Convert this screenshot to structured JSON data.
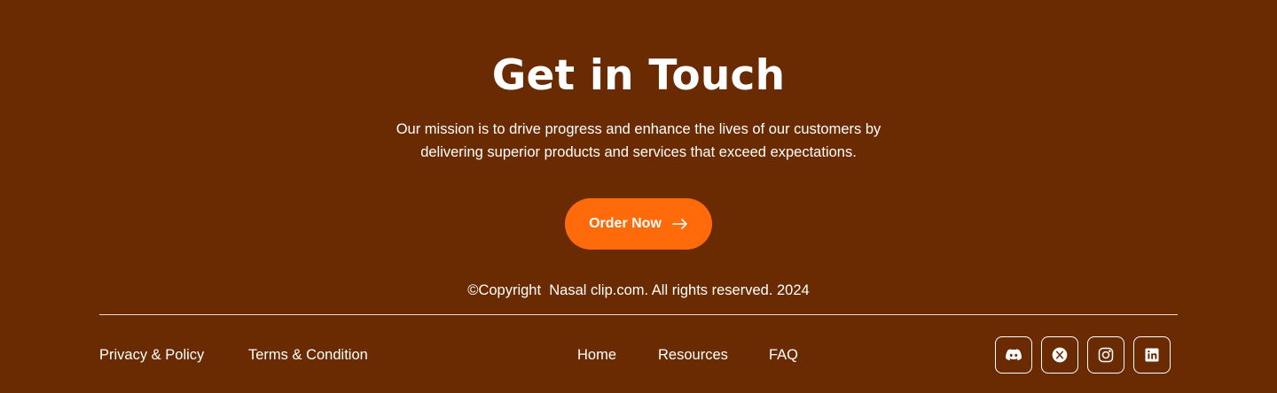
{
  "contact": {
    "title": "Get in Touch",
    "mission_line1": "Our mission is to drive progress and enhance the lives of our customers by",
    "mission_line2": "delivering superior products and services that exceed expectations.",
    "cta_label": "Order Now",
    "cta_icon": "arrow-right-icon"
  },
  "footer": {
    "copyright": "©Copyright  Nasal clip.com. All rights reserved. 2024",
    "legal_links": [
      "Privacy & Policy",
      "Terms & Condition"
    ],
    "nav_links": [
      "Home",
      "Resources",
      "FAQ"
    ],
    "socials": [
      "discord-icon",
      "x-icon",
      "instagram-icon",
      "linkedin-icon"
    ]
  },
  "colors": {
    "background": "#6b2b02",
    "accent": "#ff6a0a",
    "text": "#ffffff"
  }
}
